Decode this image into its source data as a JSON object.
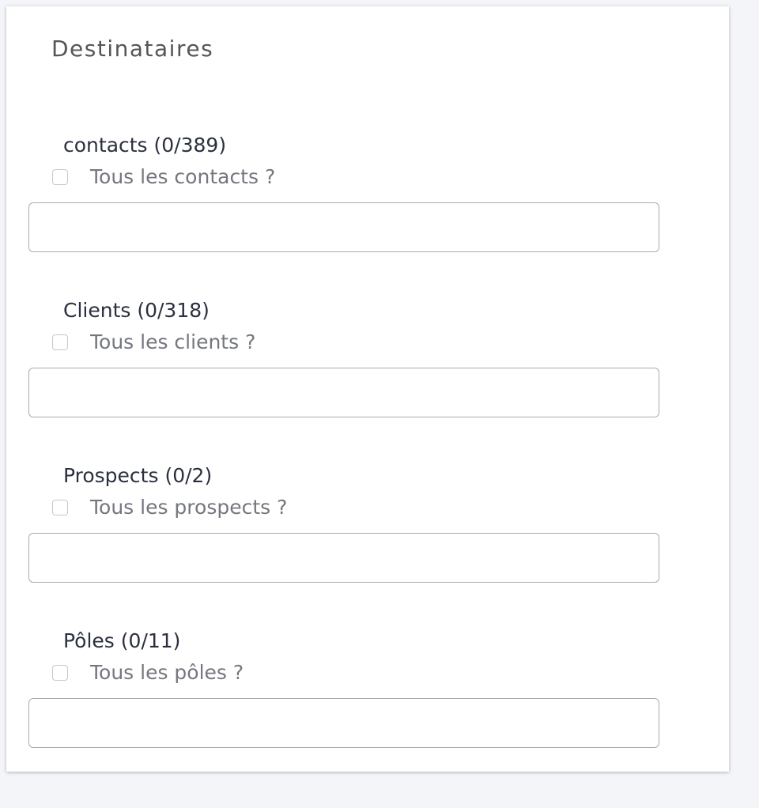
{
  "section": {
    "title": "Destinataires"
  },
  "groups": [
    {
      "label": "contacts (0/389)",
      "checkbox_label": "Tous les contacts ?",
      "checked": false,
      "value": ""
    },
    {
      "label": "Clients (0/318)",
      "checkbox_label": "Tous les clients ?",
      "checked": false,
      "value": ""
    },
    {
      "label": "Prospects (0/2)",
      "checkbox_label": "Tous les prospects ?",
      "checked": false,
      "value": ""
    },
    {
      "label": "Pôles (0/11)",
      "checkbox_label": "Tous les pôles ?",
      "checked": false,
      "value": ""
    }
  ],
  "colors": {
    "background": "#f4f5f9",
    "card": "#ffffff",
    "label": "#2b3040",
    "muted_text": "#74777e",
    "input_border": "#a9abaf"
  }
}
